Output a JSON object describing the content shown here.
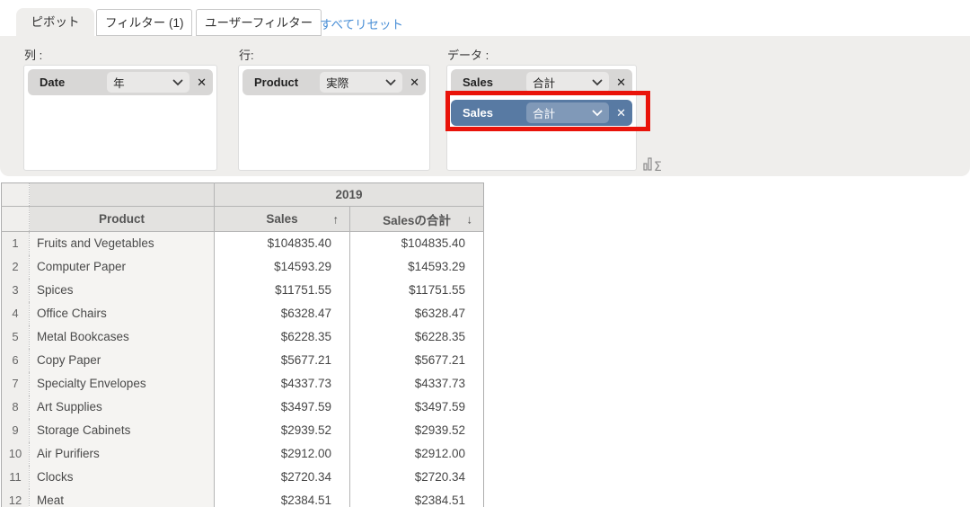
{
  "header": {
    "tabs": [
      {
        "label": "ピボット",
        "active": true
      },
      {
        "label": "フィルター (1)",
        "active": false
      },
      {
        "label": "ユーザーフィルター",
        "active": false
      }
    ],
    "reset_link": "すべてリセット"
  },
  "builder": {
    "columns_label": "列 :",
    "rows_label": "行:",
    "data_label": "データ :",
    "columns_pill": {
      "field": "Date",
      "aggregate": "年"
    },
    "rows_pill": {
      "field": "Product",
      "aggregate": "実際"
    },
    "data_pills": [
      {
        "field": "Sales",
        "aggregate": "合計",
        "highlighted": false
      },
      {
        "field": "Sales",
        "aggregate": "合計",
        "highlighted": true
      }
    ],
    "close_glyph": "✕"
  },
  "annotation": {
    "shape": "red-rectangle",
    "target": "second-sales-pill",
    "color": "#e9130a"
  },
  "colors": {
    "panel_bg": "#efeeec",
    "pill_gray": "#d8d7d6",
    "pill_blue": "#587aa3",
    "link_blue": "#4a8fd6",
    "annotation_red": "#e9130a"
  },
  "table": {
    "year_header": "2019",
    "product_header": "Product",
    "sales_header": "Sales",
    "sales_total_header": "Salesの合計",
    "sales_sort": "↑",
    "sales_total_sort": "↓",
    "rows": [
      {
        "n": "1",
        "product": "Fruits and Vegetables",
        "sales": "$104835.40",
        "total": "$104835.40"
      },
      {
        "n": "2",
        "product": "Computer Paper",
        "sales": "$14593.29",
        "total": "$14593.29"
      },
      {
        "n": "3",
        "product": "Spices",
        "sales": "$11751.55",
        "total": "$11751.55"
      },
      {
        "n": "4",
        "product": "Office Chairs",
        "sales": "$6328.47",
        "total": "$6328.47"
      },
      {
        "n": "5",
        "product": "Metal Bookcases",
        "sales": "$6228.35",
        "total": "$6228.35"
      },
      {
        "n": "6",
        "product": "Copy Paper",
        "sales": "$5677.21",
        "total": "$5677.21"
      },
      {
        "n": "7",
        "product": "Specialty Envelopes",
        "sales": "$4337.73",
        "total": "$4337.73"
      },
      {
        "n": "8",
        "product": "Art Supplies",
        "sales": "$3497.59",
        "total": "$3497.59"
      },
      {
        "n": "9",
        "product": "Storage Cabinets",
        "sales": "$2939.52",
        "total": "$2939.52"
      },
      {
        "n": "10",
        "product": "Air Purifiers",
        "sales": "$2912.00",
        "total": "$2912.00"
      },
      {
        "n": "11",
        "product": "Clocks",
        "sales": "$2720.34",
        "total": "$2720.34"
      },
      {
        "n": "12",
        "product": "Meat",
        "sales": "$2384.51",
        "total": "$2384.51"
      }
    ]
  }
}
